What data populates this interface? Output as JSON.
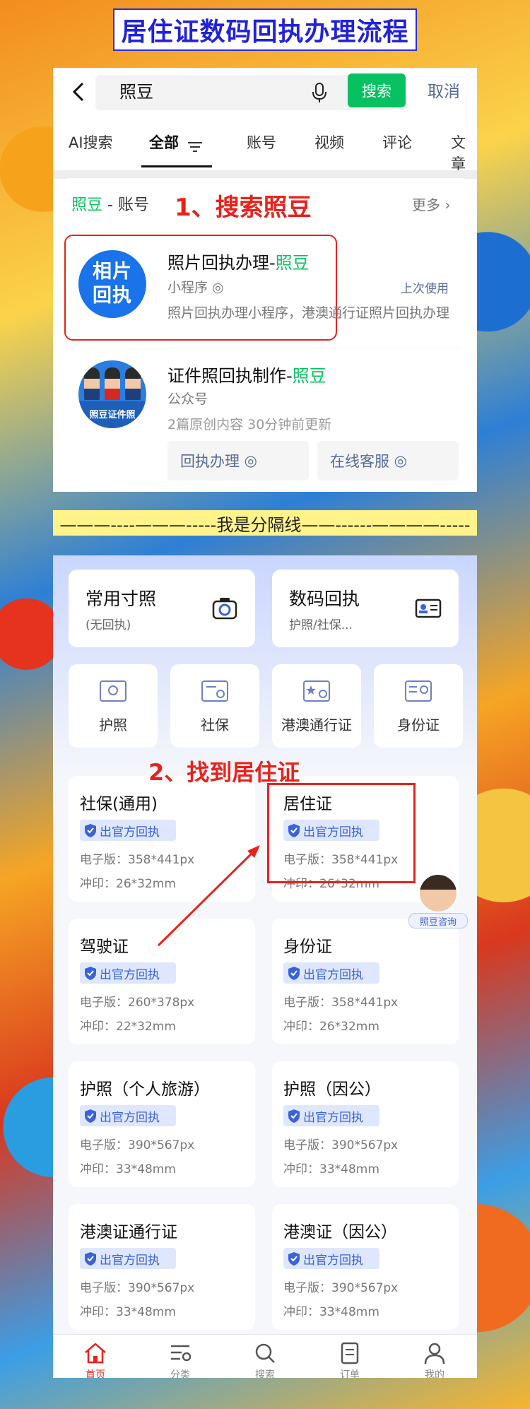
{
  "title": "居住证数码回执办理流程",
  "search": {
    "query": "照豆",
    "button": "搜索",
    "cancel": "取消"
  },
  "tabs": [
    "AI搜索",
    "全部",
    "账号",
    "视频",
    "评论",
    "文章"
  ],
  "account_section": {
    "head_green": "照豆",
    "head_rest": " - 账号",
    "more": "更多",
    "step_label": "1、搜索照豆"
  },
  "results": [
    {
      "logo_line1": "相片",
      "logo_line2": "回执",
      "title_prefix": "照片回执办理-",
      "title_highlight": "照豆",
      "type": "小程序",
      "desc": "照片回执办理小程序，港澳通行证照片回执办理",
      "last_used": "上次使用"
    },
    {
      "logo_text": "照豆证件照",
      "title_prefix": "证件照回执制作-",
      "title_highlight": "照豆",
      "type": "公众号",
      "meta": "2篇原创内容  30分钟前更新",
      "buttons": [
        "回执办理",
        "在线客服"
      ]
    }
  ],
  "separator": "———----———-----我是分隔线——------————-----",
  "quick_cards": [
    {
      "title": "常用寸照",
      "sub": "(无回执)",
      "icon": "camera-icon"
    },
    {
      "title": "数码回执",
      "sub": "护照/社保...",
      "icon": "id-card-icon"
    }
  ],
  "doc_types": [
    "护照",
    "社保",
    "港澳通行证",
    "身份证"
  ],
  "step2_label": "2、找到居住证",
  "badge_text": "出官方回执",
  "specs": [
    {
      "name": "社保(通用)",
      "digital": "电子版：358*441px",
      "print": "冲印：26*32mm"
    },
    {
      "name": "居住证",
      "digital": "电子版：358*441px",
      "print": "冲印：26*32mm"
    },
    {
      "name": "驾驶证",
      "digital": "电子版：260*378px",
      "print": "冲印：22*32mm"
    },
    {
      "name": "身份证",
      "digital": "电子版：358*441px",
      "print": "冲印：26*32mm"
    },
    {
      "name": "护照（个人旅游）",
      "digital": "电子版：390*567px",
      "print": "冲印：33*48mm"
    },
    {
      "name": "护照（因公）",
      "digital": "电子版：390*567px",
      "print": "冲印：33*48mm"
    },
    {
      "name": "港澳证通行证",
      "digital": "电子版：390*567px",
      "print": "冲印：33*48mm"
    },
    {
      "name": "港澳证（因公）",
      "digital": "电子版：390*567px",
      "print": "冲印：33*48mm"
    }
  ],
  "consult": "照豆咨询",
  "nav": [
    "首页",
    "分类",
    "搜索",
    "订单",
    "我的"
  ],
  "colors": {
    "accent_green": "#07c160",
    "step_red": "#e8221b",
    "title_blue": "#2222d8",
    "link_blue": "#576b95"
  }
}
